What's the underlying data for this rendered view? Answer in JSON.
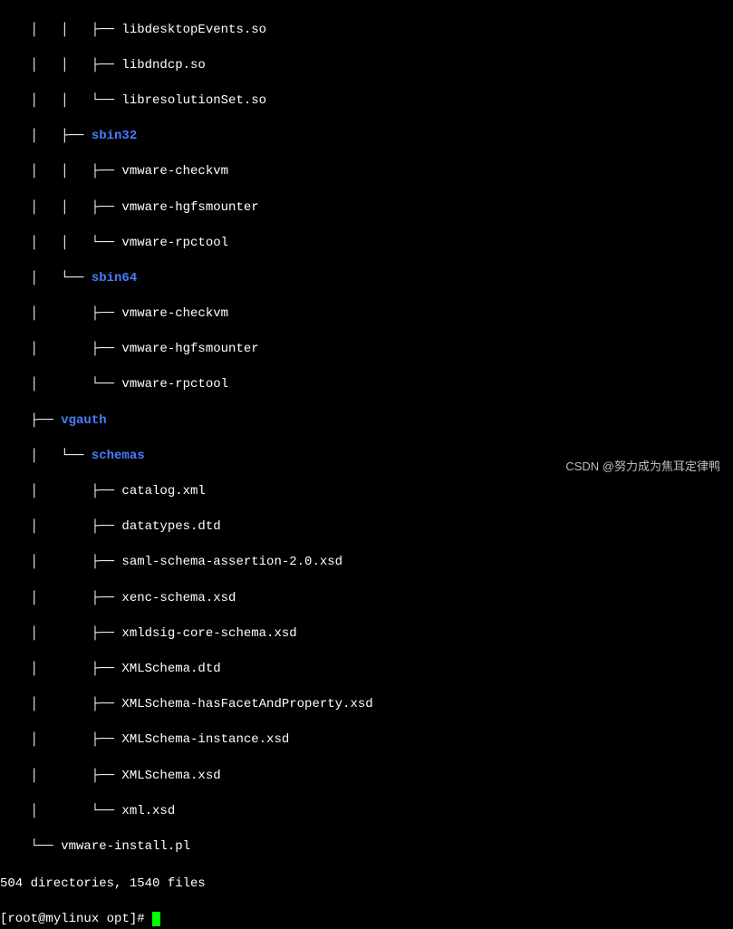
{
  "tree": {
    "l0": "    │   │   ├── libdesktopEvents.so",
    "l1": "    │   │   ├── libdndcp.so",
    "l2": "    │   │   └── libresolutionSet.so",
    "l3a": "    │   ├── ",
    "l3b": "sbin32",
    "l4": "    │   │   ├── vmware-checkvm",
    "l5": "    │   │   ├── vmware-hgfsmounter",
    "l6": "    │   │   └── vmware-rpctool",
    "l7a": "    │   └── ",
    "l7b": "sbin64",
    "l8": "    │       ├── vmware-checkvm",
    "l9": "    │       ├── vmware-hgfsmounter",
    "l10": "    │       └── vmware-rpctool",
    "l11a": "    ├── ",
    "l11b": "vgauth",
    "l12a": "    │   └── ",
    "l12b": "schemas",
    "l13": "    │       ├── catalog.xml",
    "l14": "    │       ├── datatypes.dtd",
    "l15": "    │       ├── saml-schema-assertion-2.0.xsd",
    "l16": "    │       ├── xenc-schema.xsd",
    "l17": "    │       ├── xmldsig-core-schema.xsd",
    "l18": "    │       ├── XMLSchema.dtd",
    "l19": "    │       ├── XMLSchema-hasFacetAndProperty.xsd",
    "l20": "    │       ├── XMLSchema-instance.xsd",
    "l21": "    │       ├── XMLSchema.xsd",
    "l22": "    │       └── xml.xsd",
    "l23": "    └── vmware-install.pl"
  },
  "summary": "504 directories, 1540 files",
  "prompt": {
    "open": "[",
    "user_host": "root@mylinux",
    "cwd": " opt",
    "close": "]# "
  },
  "watermark": "CSDN @努力成为焦耳定律鸭"
}
